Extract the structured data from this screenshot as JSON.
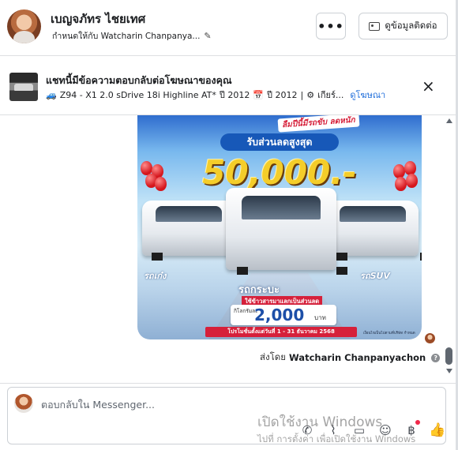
{
  "header": {
    "name": "เบญจภัทร ไชยเทศ",
    "assigned": "กำหนดให้กับ Watcharin Chanpanya...",
    "more_label": "•••",
    "contact_label": "ดูข้อมูลติดต่อ"
  },
  "ad": {
    "title": "แชทนี้มีข้อความตอบกลับต่อโฆษณาของคุณ",
    "car_label": "Z94 - X1 2.0 sDrive 18i Highline AT*",
    "year1": "ปี 2012",
    "year2": "ปี 2012",
    "gear": "เกียร์...",
    "link": "ดูโฆษณา",
    "close": "×"
  },
  "promo": {
    "ribbon": "ลืมปีนี้มีรถขับ ลดหนัก",
    "discount_label": "รับส่วนลดสูงสุด",
    "big_amount": "50,000.-",
    "left_car": "รถเก๋ง",
    "center_car": "รถกระบะ",
    "right_car": "รถSUV",
    "sub_tag": "ใช้ข้าวสารมาแลกเป็นส่วนลด",
    "price_pre": "กิโลกรัมละ",
    "price": "2,000",
    "price_unit": "บาท",
    "promo_bar": "โปรโมชั่นตั้งแต่วันที่ 1 - 31 ธันวาคม 2568",
    "fineprint": "เงื่อนไขเป็นไปตามที่บริษัท กำหนด"
  },
  "message": {
    "sent_prefix": "ส่งโดย",
    "sender": "Watcharin Chanpanyachon",
    "info": "?"
  },
  "composer": {
    "placeholder": "ตอบกลับใน Messenger..."
  },
  "watermark": {
    "line1": "เปิดใช้งาน Windows",
    "line2": "ไปที่ การตั้งค่า เพื่อเปิดใช้งาน Windows"
  }
}
